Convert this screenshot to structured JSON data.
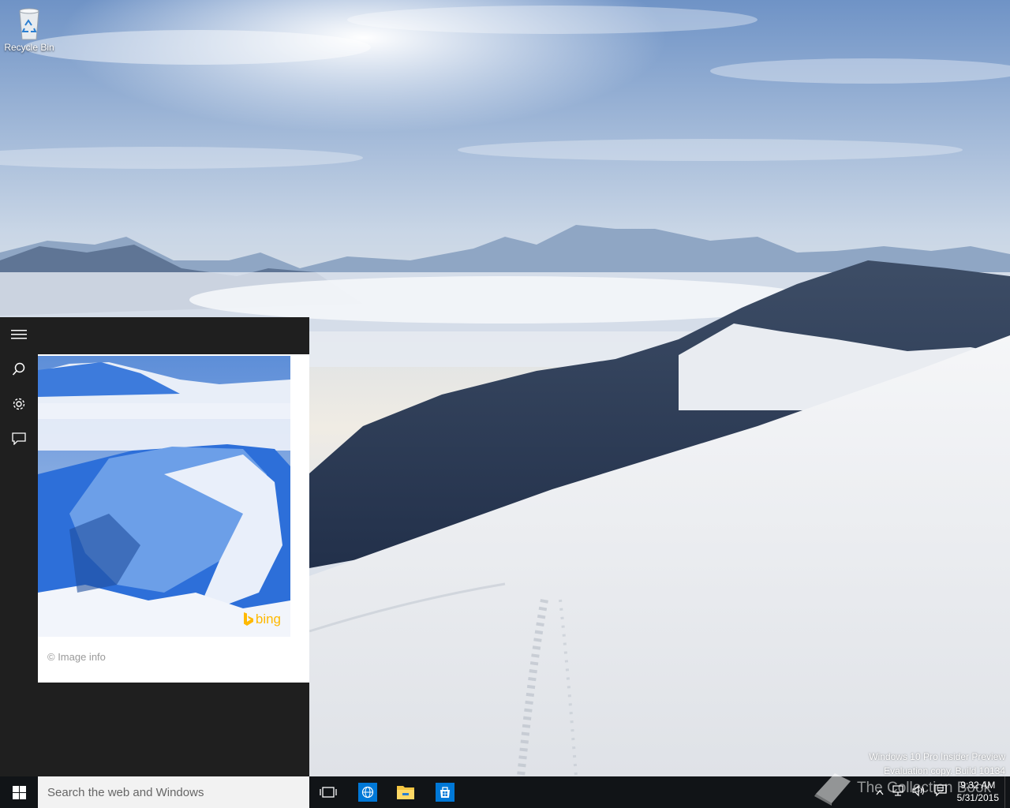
{
  "desktop": {
    "icons": [
      {
        "label": "Recycle Bin",
        "icon": "recycle-bin-icon"
      }
    ],
    "watermark": {
      "line1": "Windows 10 Pro Insider Preview",
      "line2": "Evaluation copy. Build 10134"
    },
    "overlay_logo": "The Collection Book"
  },
  "cortana": {
    "rail": [
      "hamburger-menu-icon",
      "search-icon",
      "gear-icon",
      "feedback-icon"
    ],
    "card": {
      "brand": "bing",
      "image_info": "© Image info"
    }
  },
  "taskbar": {
    "start_icon": "windows-logo-icon",
    "search_placeholder": "Search the web and Windows",
    "pinned": [
      "task-view-icon",
      "globe-icon",
      "file-explorer-icon",
      "store-icon"
    ],
    "tray_icons": [
      "chevron-up-icon",
      "network-icon",
      "volume-icon",
      "action-center-icon"
    ],
    "clock": {
      "time": "9:32 AM",
      "date": "5/31/2015"
    },
    "colors": {
      "taskbar": "#111417",
      "accent": "#0078d7"
    }
  }
}
